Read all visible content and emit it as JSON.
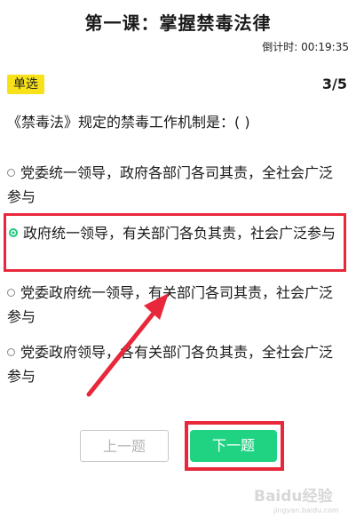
{
  "header": {
    "title": "第一课：掌握禁毒法律",
    "timer_label": "倒计时: 00:19:35"
  },
  "question_meta": {
    "type_label": "单选",
    "progress": "3/5"
  },
  "question": {
    "text": "《禁毒法》规定的禁毒工作机制是：( )"
  },
  "options": [
    {
      "text": "党委统一领导，政府各部门各司其责，全社会广泛参与",
      "selected": false
    },
    {
      "text": "政府统一领导，有关部门各负其责，社会广泛参与",
      "selected": true
    },
    {
      "text": "党委政府统一领导，有关部门各司其责，社会广泛参与",
      "selected": false
    },
    {
      "text": "党委政府领导，各有关部门各负其责，全社会广泛参与",
      "selected": false
    }
  ],
  "buttons": {
    "prev_label": "上一题",
    "next_label": "下一题"
  },
  "annotations": {
    "highlight_color": "#e8283a",
    "accent_color": "#1fd383",
    "badge_color": "#f7e21a"
  },
  "watermark": {
    "logo": "Baidu经验",
    "sub": "jingyan.baidu.com"
  }
}
